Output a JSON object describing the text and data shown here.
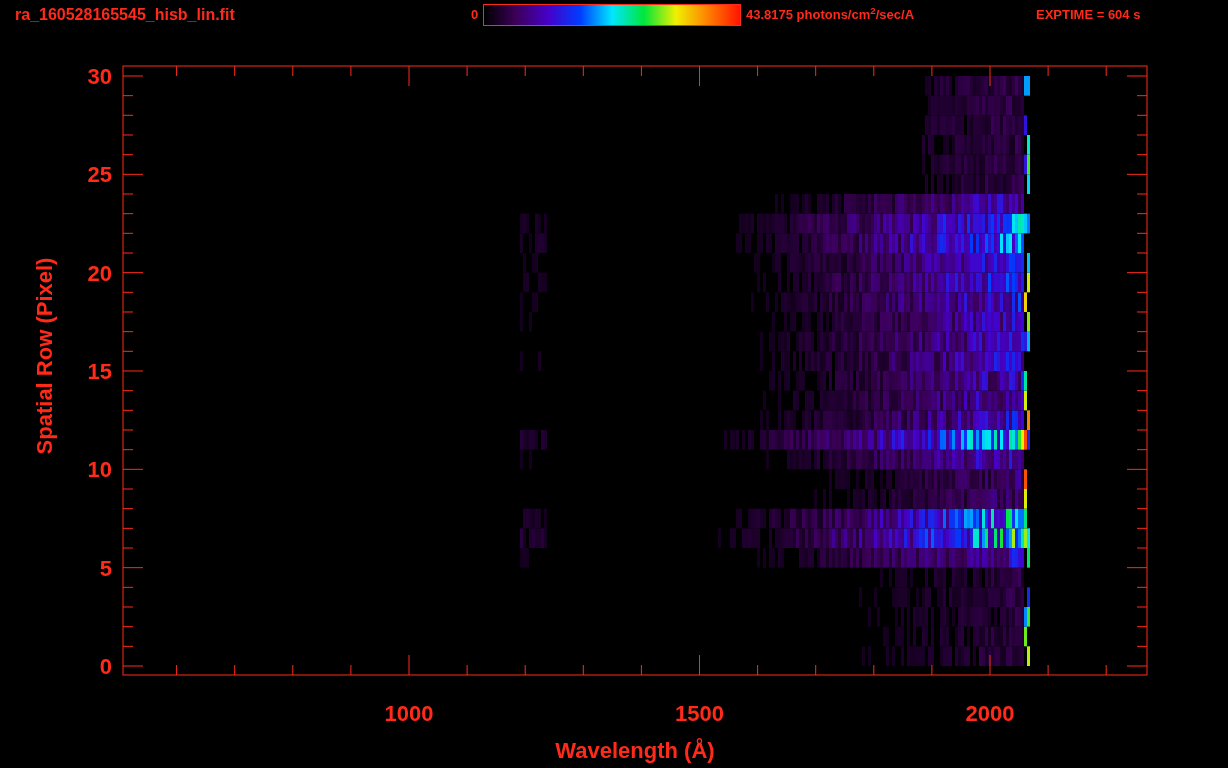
{
  "header": {
    "filename": "ra_160528165545_hisb_lin.fit",
    "colorbar": {
      "min_label": "0",
      "max_label": "43.8175 photons/cm$^{2}$/sec/A"
    },
    "exposure": "EXPTIME = 604 s"
  },
  "plot": {
    "x_axis": {
      "label": "Wavelength (Å)",
      "ticks": [
        "1000",
        "1500",
        "2000"
      ]
    },
    "y_axis": {
      "label": "Spatial Row (Pixel)",
      "ticks": [
        "30",
        "25",
        "20",
        "15",
        "10",
        "5",
        "0"
      ]
    }
  }
}
